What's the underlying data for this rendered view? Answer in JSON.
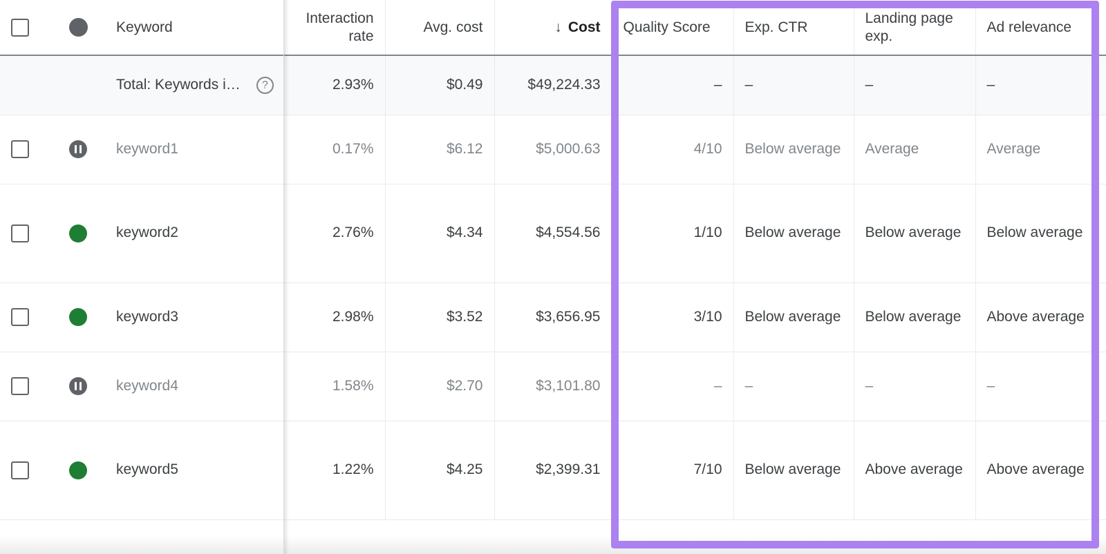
{
  "table": {
    "columns": [
      {
        "key": "checkbox",
        "label": "",
        "icon": "checkbox-icon",
        "align": "center"
      },
      {
        "key": "status",
        "label": "",
        "icon": "status-dot-icon",
        "align": "center"
      },
      {
        "key": "keyword",
        "label": "Keyword",
        "align": "left"
      },
      {
        "key": "interaction_rate",
        "label": "Interaction rate",
        "align": "right"
      },
      {
        "key": "avg_cost",
        "label": "Avg. cost",
        "align": "right"
      },
      {
        "key": "cost",
        "label": "Cost",
        "align": "right",
        "sorted": true,
        "sort_direction": "descending",
        "sort_glyph": "↓"
      },
      {
        "key": "quality_score",
        "label": "Quality Score",
        "align": "right"
      },
      {
        "key": "exp_ctr",
        "label": "Exp. CTR",
        "align": "left"
      },
      {
        "key": "landing_page_exp",
        "label": "Landing page exp.",
        "align": "left"
      },
      {
        "key": "ad_relevance",
        "label": "Ad relevance",
        "align": "left"
      }
    ],
    "total_row": {
      "label": "Total: Keywords in your curren…",
      "help_icon": "help-circle-icon",
      "help_glyph": "?",
      "interaction_rate": "2.93%",
      "avg_cost": "$0.49",
      "cost": "$49,224.33",
      "quality_score": "–",
      "exp_ctr": "–",
      "landing_page_exp": "–",
      "ad_relevance": "–"
    },
    "rows": [
      {
        "status": "paused",
        "status_icon": "pause-circle-icon",
        "keyword": "keyword1",
        "interaction_rate": "0.17%",
        "avg_cost": "$6.12",
        "cost": "$5,000.63",
        "quality_score": "4/10",
        "exp_ctr": "Below average",
        "landing_page_exp": "Average",
        "ad_relevance": "Average"
      },
      {
        "status": "enabled",
        "status_icon": "enabled-dot-icon",
        "keyword": "keyword2",
        "interaction_rate": "2.76%",
        "avg_cost": "$4.34",
        "cost": "$4,554.56",
        "quality_score": "1/10",
        "exp_ctr": "Below average",
        "landing_page_exp": "Below average",
        "ad_relevance": "Below average"
      },
      {
        "status": "enabled",
        "status_icon": "enabled-dot-icon",
        "keyword": "keyword3",
        "interaction_rate": "2.98%",
        "avg_cost": "$3.52",
        "cost": "$3,656.95",
        "quality_score": "3/10",
        "exp_ctr": "Below average",
        "landing_page_exp": "Below average",
        "ad_relevance": "Above average"
      },
      {
        "status": "paused",
        "status_icon": "pause-circle-icon",
        "keyword": "keyword4",
        "interaction_rate": "1.58%",
        "avg_cost": "$2.70",
        "cost": "$3,101.80",
        "quality_score": "–",
        "exp_ctr": "–",
        "landing_page_exp": "–",
        "ad_relevance": "–"
      },
      {
        "status": "enabled",
        "status_icon": "enabled-dot-icon",
        "keyword": "keyword5",
        "interaction_rate": "1.22%",
        "avg_cost": "$4.25",
        "cost": "$2,399.31",
        "quality_score": "7/10",
        "exp_ctr": "Below average",
        "landing_page_exp": "Above average",
        "ad_relevance": "Above average"
      }
    ]
  },
  "annotation": {
    "highlight_color": "#ab82f0",
    "highlight_target": "quality-score-columns"
  },
  "colors": {
    "enabled_dot": "#1e7e34",
    "paused_dot": "#5f6368",
    "header_dot": "#5f6368",
    "text": "#3c4043",
    "muted_text": "#80868b",
    "grid": "#e8eaed",
    "total_row_bg": "#f8f9fa"
  }
}
